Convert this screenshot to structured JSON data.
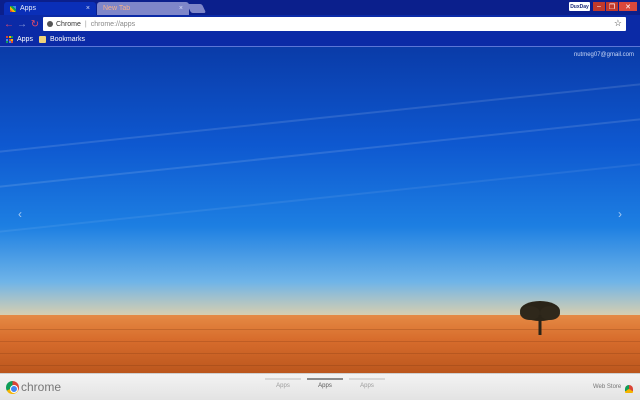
{
  "tabs": [
    {
      "label": "Apps",
      "active": true
    },
    {
      "label": "New Tab",
      "active": false
    }
  ],
  "window": {
    "profile_label": "DuxDay",
    "minimize_icon": "minimize-icon",
    "maximize_icon": "maximize-icon",
    "close_icon": "close-icon"
  },
  "toolbar": {
    "site_label": "Chrome",
    "url": "chrome://apps",
    "star_icon": "star-icon"
  },
  "bookmarks": [
    {
      "label": "Apps",
      "icon": "apps-grid-icon"
    },
    {
      "label": "Bookmarks",
      "icon": "folder-icon"
    }
  ],
  "page": {
    "email": "nutmeg07@gmail.com"
  },
  "bottom": {
    "brand": "chrome",
    "page_tabs": [
      "Apps",
      "Apps",
      "Apps"
    ],
    "selected_page_tab": 1,
    "webstore_label": "Web Store"
  },
  "colors": {
    "titlebar": "#0b1f8c",
    "toolbar": "#0b2aa6",
    "accent_red": "#e34b6b"
  }
}
